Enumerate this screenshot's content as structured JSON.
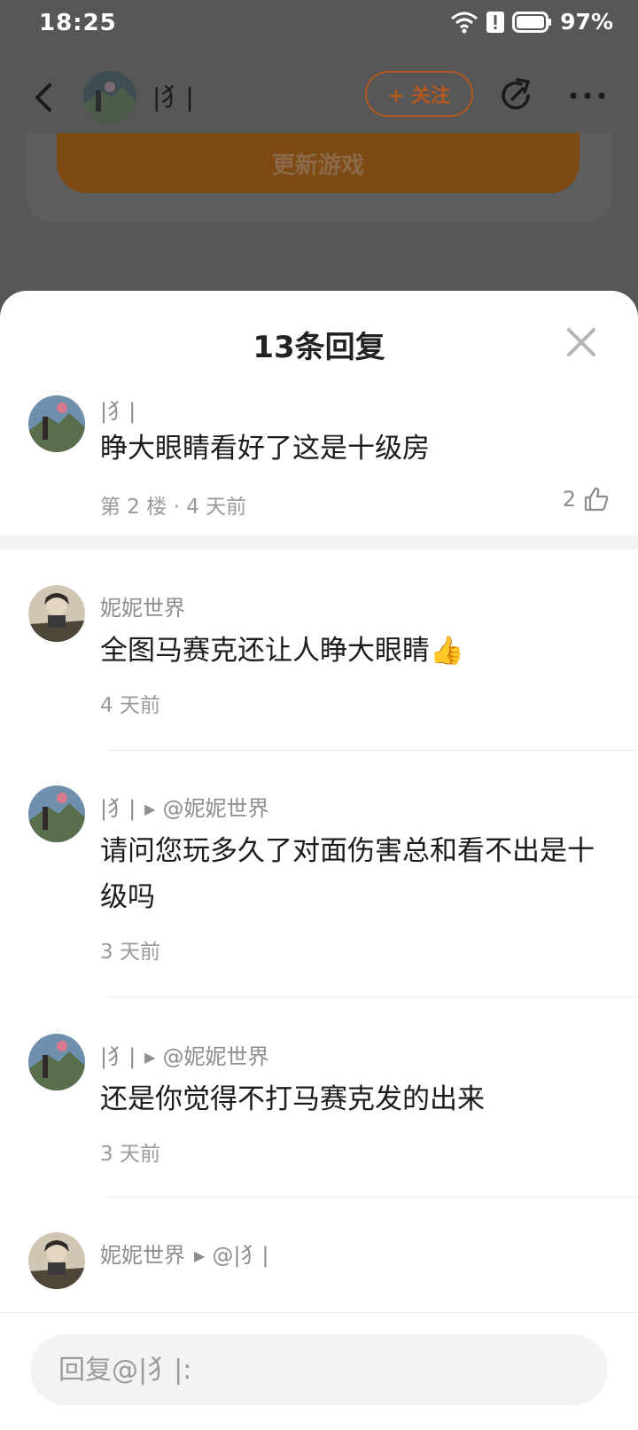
{
  "status_bar": {
    "time": "18:25",
    "battery": "97%"
  },
  "header": {
    "username": "|犭|",
    "follow_label": "+ 关注"
  },
  "background_card": {
    "update_label": "更新游戏"
  },
  "sheet": {
    "title": "13条回复",
    "top_comment": {
      "author": "|犭|",
      "text": "睁大眼睛看好了这是十级房",
      "meta": "第 2 楼 · 4 天前",
      "likes": "2"
    },
    "replies": [
      {
        "author": "妮妮世界",
        "reply_to": "",
        "text": "全图马赛克还让人睁大眼睛👍",
        "time": "4 天前"
      },
      {
        "author": "|犭|",
        "reply_to": "@妮妮世界",
        "text": "请问您玩多久了对面伤害总和看不出是十级吗",
        "time": "3 天前"
      },
      {
        "author": "|犭|",
        "reply_to": "@妮妮世界",
        "text": "还是你觉得不打马赛克发的出来",
        "time": "3 天前"
      },
      {
        "author": "妮妮世界",
        "reply_to": "@|犭|",
        "text": "",
        "time": ""
      }
    ]
  },
  "reply_box": {
    "placeholder": "回复@|犭|:"
  },
  "colors": {
    "accent": "#b2581f",
    "sheet_bg": "#ffffff",
    "overlay": "#575757"
  }
}
